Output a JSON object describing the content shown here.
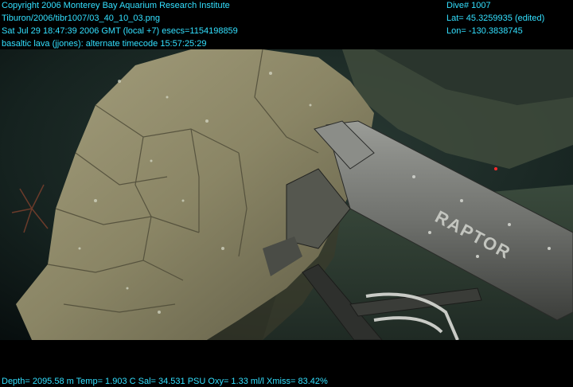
{
  "overlay": {
    "copyright": "Copyright 2006 Monterey Bay Aquarium Research Institute",
    "file_path": "Tiburon/2006/tibr1007/03_40_10_03.png",
    "datetime": "Sat Jul 29 18:47:39 2006 GMT (local +7)  esecs=1154198859",
    "description": "basaltic lava (jjones): alternate timecode 15:57:25:29",
    "dive": "Dive# 1007",
    "lat": "Lat= 45.3259935 (edited)",
    "lon": "Lon= -130.3838745",
    "telemetry": "Depth= 2095.58 m  Temp= 1.903 C  Sal= 34.531 PSU  Oxy= 1.33 ml/l  Xmiss= 83.42%"
  },
  "arm": {
    "label": "RAPTOR"
  },
  "colors": {
    "overlay_text": "#33e0ff",
    "water": "#0f1e22",
    "rock": "#8a8a66",
    "arm": "#7d7f7a"
  }
}
